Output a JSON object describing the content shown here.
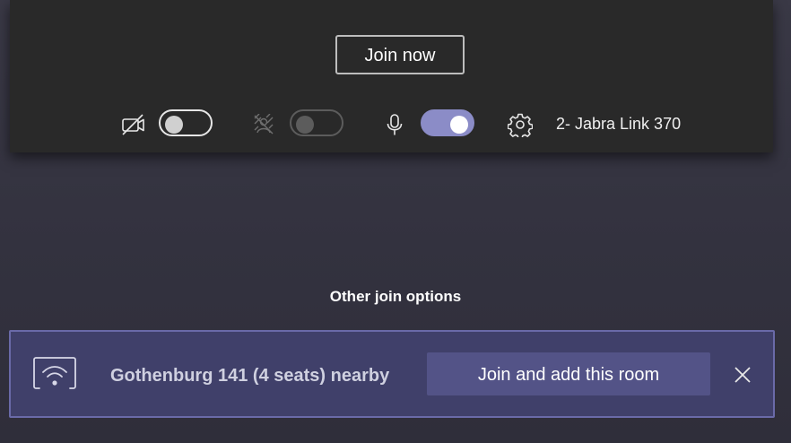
{
  "prejoin": {
    "join_now_label": "Join now",
    "controls": {
      "camera": {
        "icon": "camera-off-icon",
        "state": "off"
      },
      "background_effects": {
        "icon": "background-blur-icon",
        "state": "disabled"
      },
      "microphone": {
        "icon": "microphone-icon",
        "state": "on"
      },
      "device_settings": {
        "icon": "gear-icon",
        "label": "2- Jabra Link 370"
      }
    }
  },
  "other_join": {
    "heading": "Other join options"
  },
  "room_suggestion": {
    "icon": "cast-wifi-icon",
    "text": "Gothenburg 141 (4 seats) nearby",
    "button_label": "Join and add this room",
    "close_icon": "close-icon"
  },
  "colors": {
    "page_bg": "#33323f",
    "panel_bg": "#292929",
    "accent": "#8b8cc7",
    "banner_bg": "#40406a",
    "banner_border": "#6a6aa8",
    "banner_button": "#535387"
  }
}
